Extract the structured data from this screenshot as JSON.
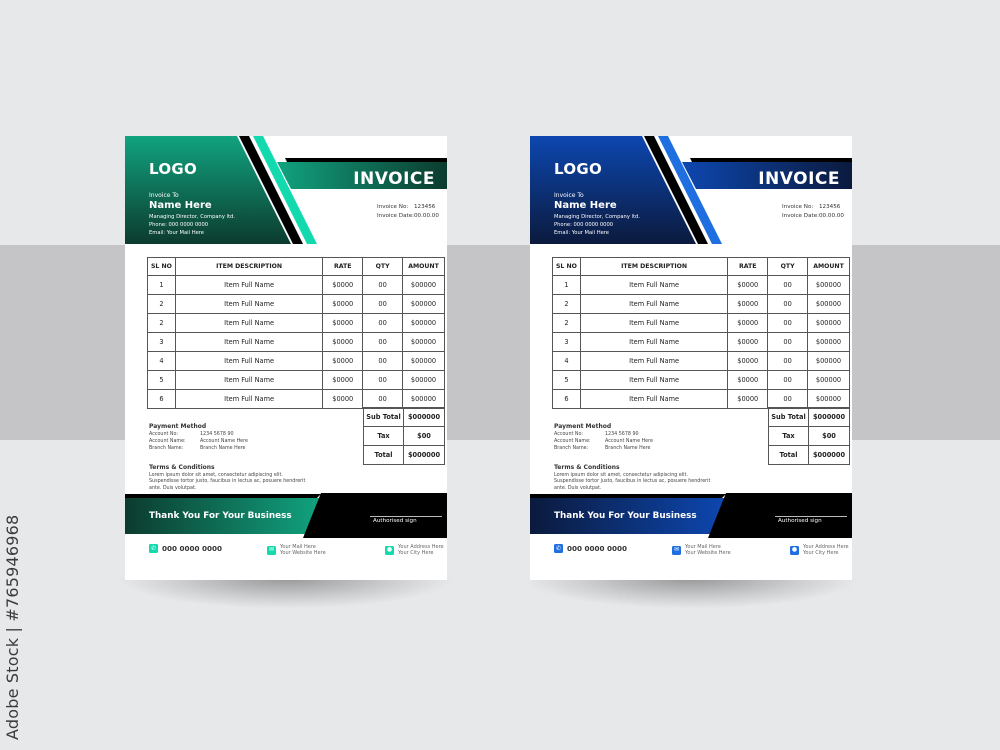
{
  "watermark": "Adobe Stock | #765946968",
  "templates": [
    {
      "theme": "green",
      "colors": {
        "accent": "#13d9ae",
        "dark": "#0c3b2e",
        "mid": "#11a37f",
        "black": "#000000"
      },
      "logo": "LOGO",
      "invoice_to_label": "Invoice To",
      "client_name": "Name Here",
      "client_lines": [
        "Managing Director, Company ltd.",
        "Phone: 000 0000 0000",
        "Email: Your Mail Here"
      ],
      "title": "INVOICE",
      "invoice_no_label": "Invoice No:",
      "invoice_no": "123456",
      "invoice_date_label": "Invoice Date:",
      "invoice_date": "00.00.00",
      "table": {
        "headers": [
          "SL NO",
          "ITEM DESCRIPTION",
          "RATE",
          "QTY",
          "AMOUNT"
        ],
        "rows": [
          [
            "1",
            "Item Full Name",
            "$0000",
            "00",
            "$00000"
          ],
          [
            "2",
            "Item Full Name",
            "$0000",
            "00",
            "$00000"
          ],
          [
            "2",
            "Item Full Name",
            "$0000",
            "00",
            "$00000"
          ],
          [
            "3",
            "Item Full Name",
            "$0000",
            "00",
            "$00000"
          ],
          [
            "4",
            "Item Full Name",
            "$0000",
            "00",
            "$00000"
          ],
          [
            "5",
            "Item Full Name",
            "$0000",
            "00",
            "$00000"
          ],
          [
            "6",
            "Item Full Name",
            "$0000",
            "00",
            "$00000"
          ]
        ]
      },
      "totals": [
        {
          "label": "Sub Total",
          "value": "$000000"
        },
        {
          "label": "Tax",
          "value": "$00"
        },
        {
          "label": "Total",
          "value": "$000000"
        }
      ],
      "payment": {
        "title": "Payment Method",
        "rows": [
          {
            "label": "Account No:",
            "value": "1234 5678 90"
          },
          {
            "label": "Account Name:",
            "value": "Account Name Here"
          },
          {
            "label": "Branch Name:",
            "value": "Branch Name Here"
          }
        ]
      },
      "terms": {
        "title": "Terms & Conditions",
        "body": "Lorem ipsum dolor sit amet, consectetur adipiscing elit. Suspendisse tortor justo, faucibus in lectus ac, posuere hendrerit ante. Duis volutpat."
      },
      "thanks": "Thank You For Your Business",
      "sign": "Authorised sign",
      "contacts": {
        "phone": "000 0000 0000",
        "mail": "Your Mail Here",
        "website": "Your Website Here",
        "address": "Your Address Here",
        "city": "Your City Here"
      }
    },
    {
      "theme": "blue",
      "colors": {
        "accent": "#1f6fe0",
        "dark": "#0b1a3d",
        "mid": "#0d47b0",
        "black": "#000000"
      },
      "logo": "LOGO",
      "invoice_to_label": "Invoice To",
      "client_name": "Name Here",
      "client_lines": [
        "Managing Director, Company ltd.",
        "Phone: 000 0000 0000",
        "Email: Your Mail Here"
      ],
      "title": "INVOICE",
      "invoice_no_label": "Invoice No:",
      "invoice_no": "123456",
      "invoice_date_label": "Invoice Date:",
      "invoice_date": "00.00.00",
      "table": {
        "headers": [
          "SL NO",
          "ITEM DESCRIPTION",
          "RATE",
          "QTY",
          "AMOUNT"
        ],
        "rows": [
          [
            "1",
            "Item Full Name",
            "$0000",
            "00",
            "$00000"
          ],
          [
            "2",
            "Item Full Name",
            "$0000",
            "00",
            "$00000"
          ],
          [
            "2",
            "Item Full Name",
            "$0000",
            "00",
            "$00000"
          ],
          [
            "3",
            "Item Full Name",
            "$0000",
            "00",
            "$00000"
          ],
          [
            "4",
            "Item Full Name",
            "$0000",
            "00",
            "$00000"
          ],
          [
            "5",
            "Item Full Name",
            "$0000",
            "00",
            "$00000"
          ],
          [
            "6",
            "Item Full Name",
            "$0000",
            "00",
            "$00000"
          ]
        ]
      },
      "totals": [
        {
          "label": "Sub Total",
          "value": "$000000"
        },
        {
          "label": "Tax",
          "value": "$00"
        },
        {
          "label": "Total",
          "value": "$000000"
        }
      ],
      "payment": {
        "title": "Payment Method",
        "rows": [
          {
            "label": "Account No:",
            "value": "1234 5678 90"
          },
          {
            "label": "Account Name:",
            "value": "Account Name Here"
          },
          {
            "label": "Branch Name:",
            "value": "Branch Name Here"
          }
        ]
      },
      "terms": {
        "title": "Terms & Conditions",
        "body": "Lorem ipsum dolor sit amet, consectetur adipiscing elit. Suspendisse tortor justo, faucibus in lectus ac, posuere hendrerit ante. Duis volutpat."
      },
      "thanks": "Thank You For Your Business",
      "sign": "Authorised sign",
      "contacts": {
        "phone": "000 0000 0000",
        "mail": "Your Mail Here",
        "website": "Your Website Here",
        "address": "Your Address Here",
        "city": "Your City Here"
      }
    }
  ]
}
